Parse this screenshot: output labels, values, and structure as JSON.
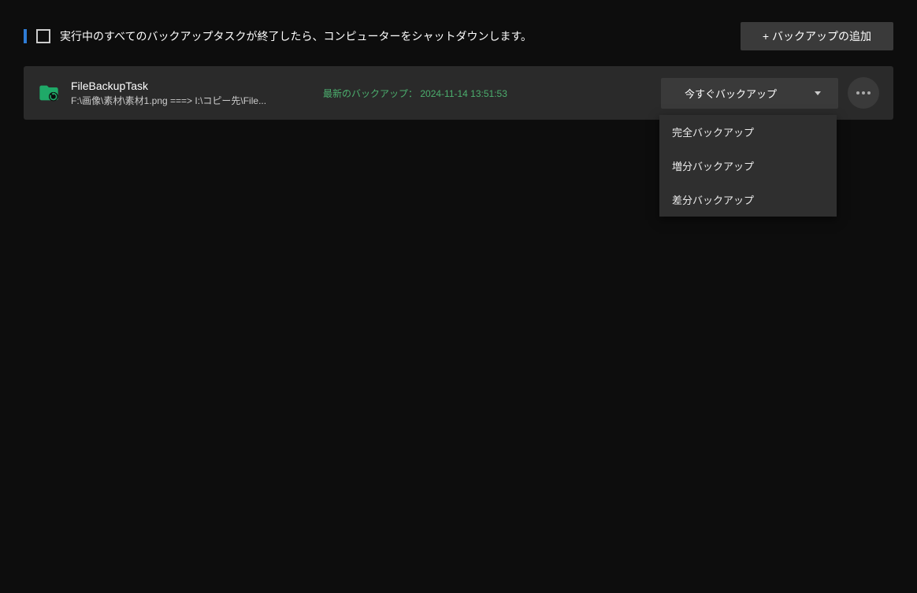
{
  "topbar": {
    "shutdown_label": "実行中のすべてのバックアップタスクが終了したら、コンピューターをシャットダウンします。",
    "add_backup_label": "+ バックアップの追加"
  },
  "task": {
    "name": "FileBackupTask",
    "path": "F:\\画像\\素材\\素材1.png ===> I:\\コピー先\\File...",
    "last_backup_label": "最新のバックアップ：",
    "last_backup_time": "2024-11-14 13:51:53",
    "backup_now_label": "今すぐバックアップ"
  },
  "dropdown": {
    "items": [
      {
        "label": "完全バックアップ"
      },
      {
        "label": "増分バックアップ"
      },
      {
        "label": "差分バックアップ"
      }
    ]
  }
}
